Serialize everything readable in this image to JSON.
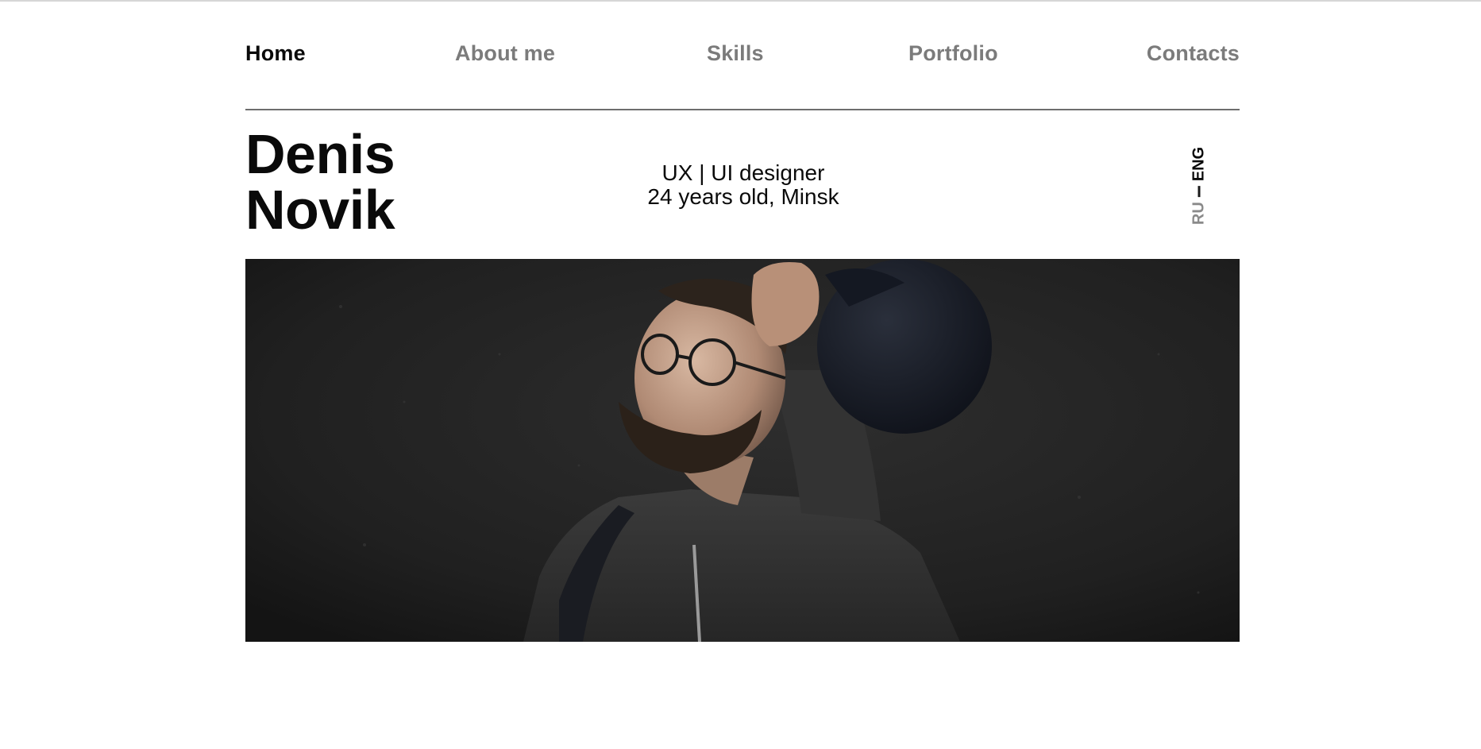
{
  "nav": {
    "items": [
      {
        "label": "Home",
        "active": true
      },
      {
        "label": "About me",
        "active": false
      },
      {
        "label": "Skills",
        "active": false
      },
      {
        "label": "Portfolio",
        "active": false
      },
      {
        "label": "Contacts",
        "active": false
      }
    ]
  },
  "hero": {
    "first_name": "Denis",
    "last_name": "Novik",
    "role": "UX | UI designer",
    "details": "24 years old, Minsk"
  },
  "language": {
    "options": [
      "RU",
      "ENG"
    ],
    "selected": "ENG"
  },
  "photo": {
    "subject": "portrait-photo"
  },
  "colors": {
    "text": "#0a0a0a",
    "nav_inactive": "#7b7b7b",
    "divider": "#6d6d6d",
    "photo_background": "#1f1f1f"
  }
}
